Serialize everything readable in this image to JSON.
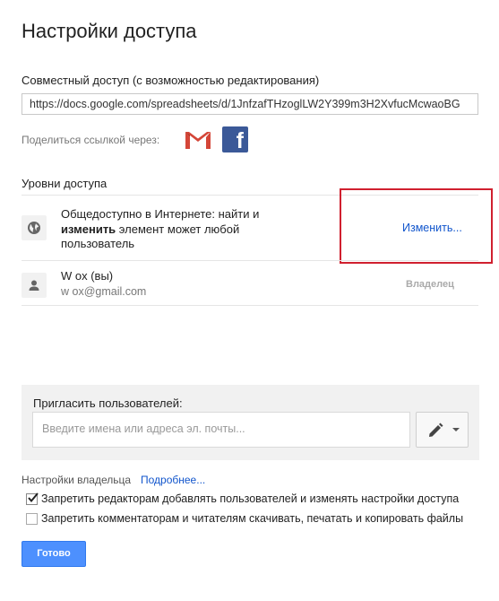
{
  "dialog": {
    "title": "Настройки доступа",
    "link_section": {
      "label": "Совместный доступ (с возможностью редактирования)",
      "link_value": "https://docs.google.com/spreadsheets/d/1JnfzafTHzoglLW2Y399m3H2XvfucMcwaoBG",
      "share_via_label": "Поделиться ссылкой через:",
      "share_icons": [
        "gmail-icon",
        "facebook-icon"
      ]
    },
    "access": {
      "heading": "Уровни доступа",
      "public_row": {
        "icon": "globe-icon",
        "text_line1": "Общедоступно в Интернете: найти и",
        "text_bold": "изменить",
        "text_line2_rest": " элемент может любой",
        "text_line3": "пользователь",
        "change_link": "Изменить..."
      },
      "owner_row": {
        "icon": "person-icon",
        "name": "W         ox (вы)",
        "email": "w          ox@gmail.com",
        "role": "Владелец"
      }
    },
    "invite": {
      "label": "Пригласить пользователей:",
      "placeholder": "Введите имена или адреса эл. почты...",
      "permission_icon": "pencil-icon"
    },
    "owner_settings": {
      "label": "Настройки владельца",
      "more_link": "Подробнее...",
      "options": [
        {
          "label": "Запретить редакторам добавлять пользователей и изменять настройки доступа",
          "checked": true
        },
        {
          "label": "Запретить комментаторам и читателям скачивать, печатать и копировать файлы",
          "checked": false
        }
      ]
    },
    "done_button": "Готово",
    "colors": {
      "accent_blue": "#4d90fe",
      "link_blue": "#1155cc",
      "highlight_red": "#d0202f",
      "facebook": "#3b5998"
    }
  }
}
